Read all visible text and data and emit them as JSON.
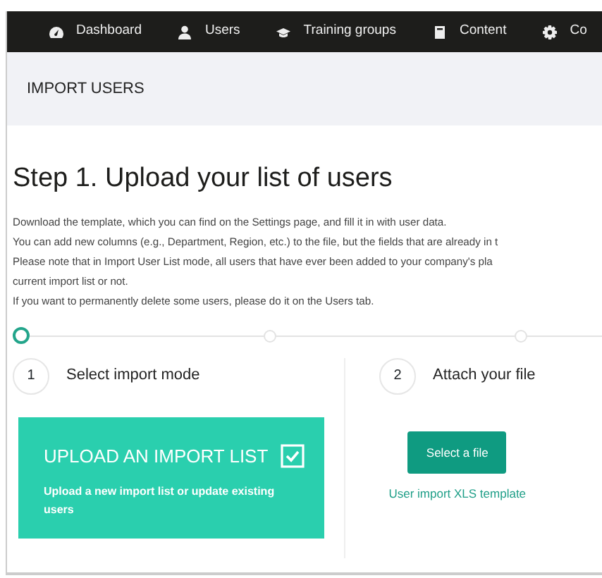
{
  "nav": [
    {
      "label": "Dashboard"
    },
    {
      "label": "Users"
    },
    {
      "label": "Training groups"
    },
    {
      "label": "Content"
    },
    {
      "label": "Co"
    }
  ],
  "header": {
    "title": "IMPORT USERS"
  },
  "step_title": "Step 1. Upload your list of users",
  "instructions": [
    "Download the template, which you can find on the Settings page, and fill it in with user data.",
    "You can add new columns (e.g., Department, Region, etc.) to the file, but the fields that are already in t",
    "Please note that in Import User List mode, all users that have ever been added to your company's pla",
    "current import list or not.",
    "If you want to permanently delete some users, please do it on the Users tab."
  ],
  "progress": [
    {
      "selected": true
    },
    {
      "selected": false
    },
    {
      "selected": false
    }
  ],
  "steps": [
    {
      "number": "1",
      "title": "Select import mode"
    },
    {
      "number": "2",
      "title": "Attach your file"
    }
  ],
  "mode_card": {
    "title": "UPLOAD AN IMPORT LIST",
    "description": "Upload a new import list or update existing users",
    "checked": true
  },
  "attach": {
    "button": "Select a file",
    "link": "User import XLS template"
  }
}
